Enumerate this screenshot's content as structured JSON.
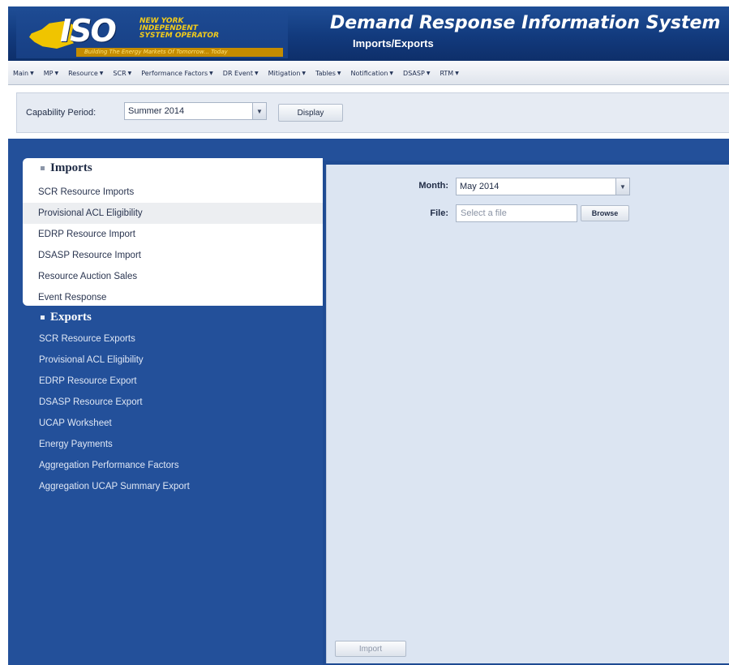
{
  "header": {
    "logo_text": "ISO",
    "org_lines": [
      "New York",
      "Independent",
      "System Operator"
    ],
    "tagline": "Building The Energy Markets Of Tomorrow... Today",
    "title": "Demand Response Information System",
    "subtitle": "Imports/Exports"
  },
  "menu": [
    {
      "label": "Main"
    },
    {
      "label": "MP"
    },
    {
      "label": "Resource"
    },
    {
      "label": "SCR"
    },
    {
      "label": "Performance Factors"
    },
    {
      "label": "DR Event"
    },
    {
      "label": "Mitigation"
    },
    {
      "label": "Tables"
    },
    {
      "label": "Notification"
    },
    {
      "label": "DSASP"
    },
    {
      "label": "RTM"
    }
  ],
  "toolbar": {
    "capability_label": "Capability Period:",
    "capability_value": "Summer 2014",
    "display_button": "Display"
  },
  "sidebar": {
    "imports_title": "Imports",
    "imports": [
      {
        "label": "SCR Resource Imports"
      },
      {
        "label": "Provisional ACL Eligibility"
      },
      {
        "label": "EDRP Resource Import"
      },
      {
        "label": "DSASP Resource Import"
      },
      {
        "label": "Resource Auction Sales"
      },
      {
        "label": "Event Response"
      }
    ],
    "exports_title": "Exports",
    "exports": [
      {
        "label": "SCR Resource Exports"
      },
      {
        "label": "Provisional ACL Eligibility"
      },
      {
        "label": "EDRP Resource Export"
      },
      {
        "label": "DSASP Resource Export"
      },
      {
        "label": "UCAP Worksheet"
      },
      {
        "label": "Energy Payments"
      },
      {
        "label": "Aggregation Performance Factors"
      },
      {
        "label": "Aggregation UCAP Summary Export"
      }
    ]
  },
  "form": {
    "month_label": "Month:",
    "month_value": "May 2014",
    "file_label": "File:",
    "file_placeholder": "Select a file",
    "browse_button": "Browse",
    "import_button": "Import"
  },
  "colors": {
    "header_blue": "#123a7d",
    "sidebar_blue": "#23509a",
    "logo_yellow": "#f0c400",
    "panel_bg": "#dce5f2"
  }
}
